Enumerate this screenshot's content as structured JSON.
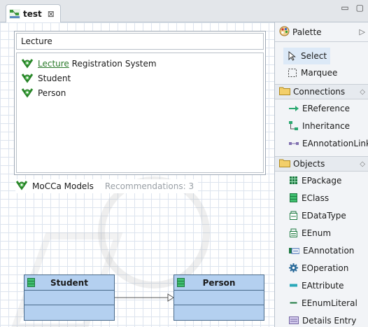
{
  "tab": {
    "title": "test",
    "close": "⊠"
  },
  "window": {
    "minimize": "▭",
    "maximize": "▢"
  },
  "popup": {
    "search_value": "Lecture",
    "items": [
      {
        "highlight": "Lecture",
        "rest": " Registration System"
      },
      {
        "highlight": "",
        "rest": "Student"
      },
      {
        "highlight": "",
        "rest": "Person"
      }
    ]
  },
  "footer": {
    "label": "MoCCa Models",
    "recommendations": "Recommendations: 3"
  },
  "diagram": {
    "class_a": "Student",
    "class_b": "Person"
  },
  "palette": {
    "title": "Palette",
    "expand": "▷",
    "tools": {
      "select": "Select",
      "marquee": "Marquee"
    },
    "connections": {
      "title": "Connections",
      "items": [
        "EReference",
        "Inheritance",
        "EAnnotationLink"
      ]
    },
    "objects": {
      "title": "Objects",
      "items": [
        "EPackage",
        "EClass",
        "EDataType",
        "EEnum",
        "EAnnotation",
        "EOperation",
        "EAttribute",
        "EEnumLiteral",
        "Details Entry"
      ]
    }
  },
  "colors": {
    "class_fill": "#b4d0f0",
    "class_border": "#4a6a8a",
    "accent_green": "#2a7a2a",
    "selected_bg": "#dce9f7"
  }
}
